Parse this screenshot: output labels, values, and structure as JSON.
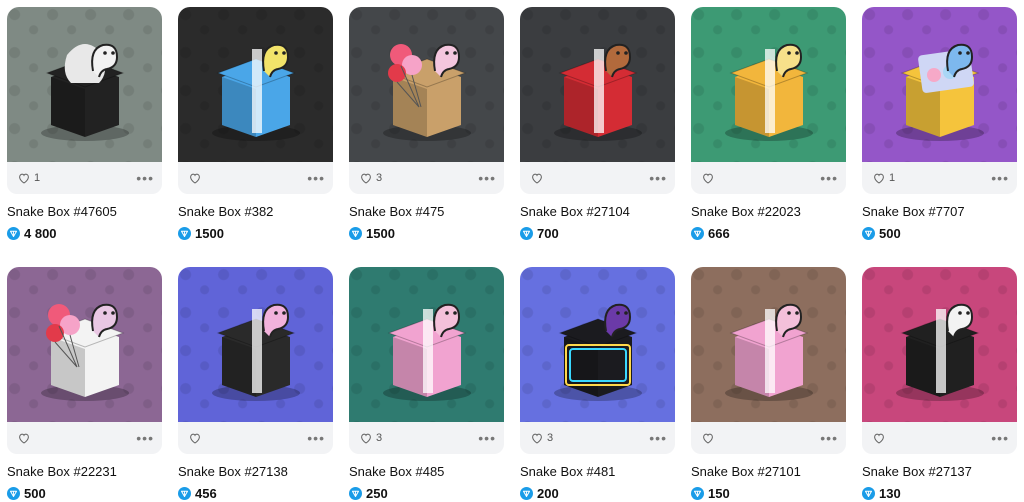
{
  "items": [
    {
      "name": "Snake Box #47605",
      "likes": "1",
      "price": "4 800",
      "bg": "#7f8a84",
      "box": "#222222",
      "snake": "#f2f2f2",
      "art": "hat"
    },
    {
      "name": "Snake Box #382",
      "likes": "",
      "price": "1500",
      "bg": "#2b2b2b",
      "box": "#4aa6e8",
      "snake": "#f2e36a",
      "art": "gift"
    },
    {
      "name": "Snake Box #475",
      "likes": "3",
      "price": "1500",
      "bg": "#44474a",
      "box": "#c9a06a",
      "snake": "#f4c6de",
      "art": "balloons"
    },
    {
      "name": "Snake Box #27104",
      "likes": "",
      "price": "700",
      "bg": "#3b3d40",
      "box": "#d42c34",
      "snake": "#b26a3c",
      "art": "gift"
    },
    {
      "name": "Snake Box #22023",
      "likes": "",
      "price": "666",
      "bg": "#3d9a74",
      "box": "#f2b63c",
      "snake": "#f7e08a",
      "art": "gift"
    },
    {
      "name": "Snake Box #7707",
      "likes": "1",
      "price": "500",
      "bg": "#9456c8",
      "box": "#f5c43c",
      "snake": "#7db8ee",
      "art": "tray"
    },
    {
      "name": "Snake Box #22231",
      "likes": "",
      "price": "500",
      "bg": "#8c6794",
      "box": "#f3f3f3",
      "snake": "#e9c7e3",
      "art": "balloons"
    },
    {
      "name": "Snake Box #27138",
      "likes": "",
      "price": "456",
      "bg": "#6064d8",
      "box": "#2a2a2a",
      "snake": "#f2b2dc",
      "art": "gift"
    },
    {
      "name": "Snake Box #485",
      "likes": "3",
      "price": "250",
      "bg": "#2f7b70",
      "box": "#f1a3d0",
      "snake": "#f4c0da",
      "art": "gift"
    },
    {
      "name": "Snake Box #481",
      "likes": "3",
      "price": "200",
      "bg": "#6670e0",
      "box": "#1b1b1f",
      "snake": "#6b3aa8",
      "art": "neon"
    },
    {
      "name": "Snake Box #27101",
      "likes": "",
      "price": "150",
      "bg": "#8d6e5e",
      "box": "#f1a3d0",
      "snake": "#f4c0da",
      "art": "gift"
    },
    {
      "name": "Snake Box #27137",
      "likes": "",
      "price": "130",
      "bg": "#c8477c",
      "box": "#202020",
      "snake": "#f3f3f3",
      "art": "gift"
    }
  ]
}
